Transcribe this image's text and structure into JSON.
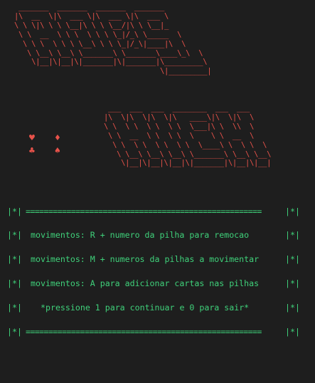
{
  "terminal": {
    "background": "#1e1e1e",
    "banner_color": "#e8524a",
    "text_color": "#3fd17a"
  },
  "banner": {
    "top_art": " _______  _______  _______  _______\n|\\  __  \\|\\  ___ \\|\\  ___ \\|\\  ___ \\\n\\ \\ \\|\\ \\ \\ \\__|\\ \\ \\ \\__/|\\ \\ \\__|_\n \\ \\  __  \\ \\ \\  \\ \\ \\ \\_|/_\\ \\_____  \\\n  \\ \\ \\  \\ \\ \\ \\__\\ \\ \\ \\_|/_\\|____|\\  \\\n   \\ \\__\\ \\__\\ \\_______\\ \\_______\\____\\_\\  \\\n    \\|__|\\|__|\\|_______|\\|_______|\\_________\\\n                                  \\|_________|",
    "bottom_art": "  ___  ___  ___  ________  ___  ___\n |\\  \\|\\  \\|\\  \\|\\   ____\\|\\  \\|\\  \\\n \\ \\  \\ \\  \\ \\  \\ \\  \\___|\\ \\  \\\\  \\\n  \\ \\  __  \\ \\  \\ \\  \\    \\ \\  __  \\\n   \\ \\  \\ \\  \\ \\  \\ \\  \\____\\ \\  \\ \\  \\\n    \\ \\__\\ \\__\\ \\__\\ \\_______\\ \\__\\ \\__\\\n     \\|__|\\|__|\\|__|\\|_______|\\|__|\\|__|"
  },
  "suits": {
    "heart": "♥",
    "diamond": "♦",
    "club": "♣",
    "spade": "♠"
  },
  "menu": {
    "marker": "|*|",
    "rule": "====================================================",
    "lines": [
      "movimentos: R + numero da pilha para remocao",
      "movimentos: M + numeros da pilhas a movimentar",
      "movimentos: A para adicionar cartas nas pilhas",
      "*pressione 1 para continuar e 0 para sair*"
    ]
  }
}
